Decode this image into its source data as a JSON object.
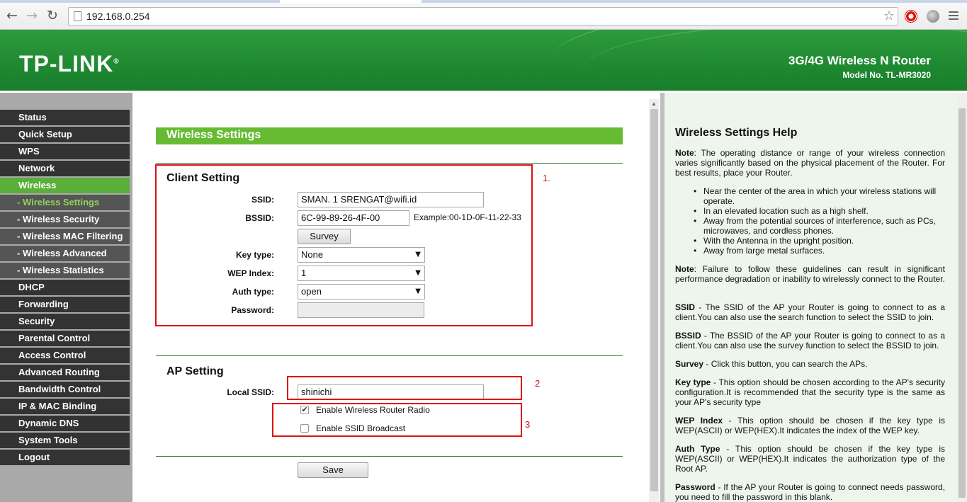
{
  "browser": {
    "url": "192.168.0.254",
    "back_glyph": "←",
    "forward_glyph": "→",
    "reload_glyph": "↻",
    "star_glyph": "☆"
  },
  "header": {
    "logo": "TP-LINK",
    "logo_mark": "®",
    "product": "3G/4G Wireless N Router",
    "model": "Model No. TL-MR3020"
  },
  "menu": {
    "items": [
      {
        "label": "Status"
      },
      {
        "label": "Quick Setup"
      },
      {
        "label": "WPS"
      },
      {
        "label": "Network"
      },
      {
        "label": "Wireless"
      },
      {
        "label": "- Wireless Settings"
      },
      {
        "label": "- Wireless Security"
      },
      {
        "label": "- Wireless MAC Filtering"
      },
      {
        "label": "- Wireless Advanced"
      },
      {
        "label": "- Wireless Statistics"
      },
      {
        "label": "DHCP"
      },
      {
        "label": "Forwarding"
      },
      {
        "label": "Security"
      },
      {
        "label": "Parental Control"
      },
      {
        "label": "Access Control"
      },
      {
        "label": "Advanced Routing"
      },
      {
        "label": "Bandwidth Control"
      },
      {
        "label": "IP & MAC Binding"
      },
      {
        "label": "Dynamic DNS"
      },
      {
        "label": "System Tools"
      },
      {
        "label": "Logout"
      }
    ]
  },
  "main": {
    "section_title": "Wireless Settings",
    "client": {
      "title": "Client Setting",
      "ssid_label": "SSID:",
      "ssid_value": "SMAN. 1 SRENGAT@wifi.id",
      "bssid_label": "BSSID:",
      "bssid_value": "6C-99-89-26-4F-00",
      "bssid_example": "Example:00-1D-0F-11-22-33",
      "survey_label": "Survey",
      "keytype_label": "Key type:",
      "keytype_value": "None",
      "wepindex_label": "WEP Index:",
      "wepindex_value": "1",
      "authtype_label": "Auth type:",
      "authtype_value": "open",
      "password_label": "Password:",
      "password_value": ""
    },
    "ap": {
      "title": "AP Setting",
      "local_ssid_label": "Local SSID:",
      "local_ssid_value": "shinichi",
      "radio_label": "Enable Wireless Router Radio",
      "radio_checked": "✔",
      "broadcast_label": "Enable SSID Broadcast",
      "broadcast_checked": ""
    },
    "save_label": "Save",
    "caret": "▼",
    "annotations": [
      "1.",
      "2",
      "3"
    ],
    "annotation_color": "#dd1111"
  },
  "help": {
    "title": "Wireless Settings Help",
    "note1_head": "Note",
    "note1_text": ": The operating distance or range of your wireless connection varies significantly based on the physical placement of the Router. For best results, place your Router.",
    "bullets": [
      "Near the center of the area in which your wireless stations will operate.",
      "In an elevated location such as a high shelf.",
      "Away from the potential sources of interference, such as PCs, microwaves, and cordless phones.",
      "With the Antenna in the upright position.",
      "Away from large metal surfaces."
    ],
    "note2_head": "Note",
    "note2_text": ": Failure to follow these guidelines can result in significant performance degradation or inability to wirelessly connect to the Router.",
    "ssid_head": "SSID",
    "ssid_text": " - The SSID of the AP your Router is going to connect to as a client.You can also use the search function to select the SSID to join.",
    "bssid_head": "BSSID",
    "bssid_text": " - The BSSID of the AP your Router is going to connect to as a client.You can also use the survey function to select the BSSID to join.",
    "survey_head": "Survey",
    "survey_text": " - Click this button, you can search the APs.",
    "keytype_head": "Key type",
    "keytype_text": " - This option should be chosen according to the AP's security configuration.It is recommended that the security type is the same as your AP's security type",
    "wep_head": "WEP Index",
    "wep_text": " - This option should be chosen if the key type is WEP(ASCII) or WEP(HEX).It indicates the index of the WEP key.",
    "auth_head": "Auth Type",
    "auth_text": " - This option should be chosen if the key type is WEP(ASCII) or WEP(HEX).It indicates the authorization type of the Root AP.",
    "pw_head": "Password",
    "pw_text": " - If the AP your Router is going to connect needs password, you need to fill the password in this blank."
  },
  "colors": {
    "banner_green": "#1f8a31",
    "section_green": "#66bb33",
    "menu_active": "#5aae3a",
    "help_bg": "#eef5ec"
  }
}
